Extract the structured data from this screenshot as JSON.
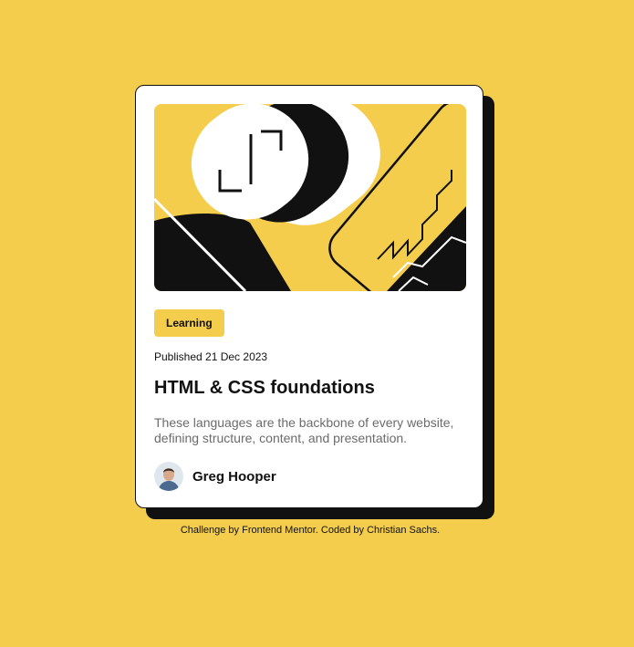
{
  "colors": {
    "background": "#f4cd4c",
    "card": "#ffffff",
    "accent": "#f4cd4c",
    "ink": "#111111",
    "muted_text": "#6b6b6b"
  },
  "card": {
    "image_icon": "abstract-illustration",
    "tag": "Learning",
    "published": "Published 21 Dec 2023",
    "title": "HTML & CSS foundations",
    "description": "These languages are the backbone of every website, defining structure, content, and presentation.",
    "author": {
      "avatar_icon": "author-avatar",
      "name": "Greg Hooper"
    }
  },
  "footer": {
    "attribution": "Challenge by Frontend Mentor. Coded by Christian Sachs."
  }
}
